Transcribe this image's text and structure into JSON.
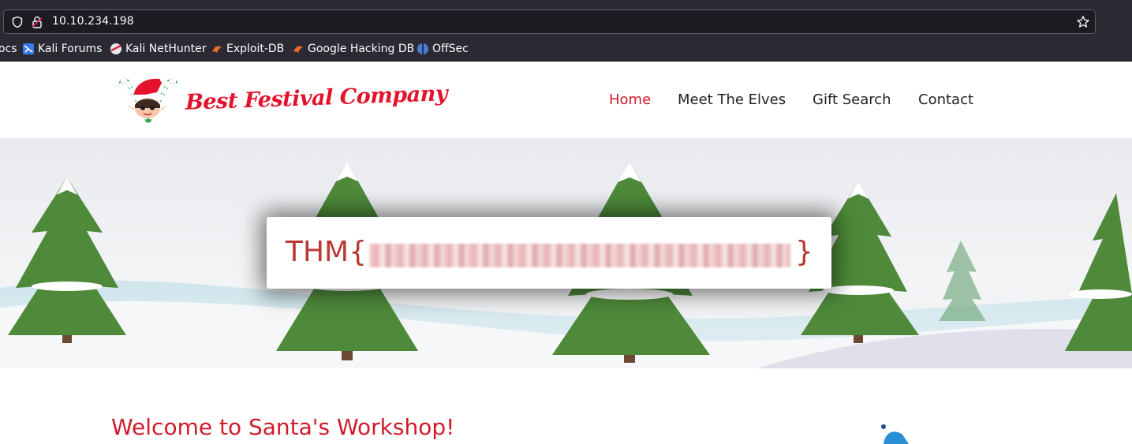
{
  "browser": {
    "url": "10.10.234.198",
    "bookmarks": [
      {
        "label": "ocs",
        "icon": "docs-icon"
      },
      {
        "label": "Kali Forums",
        "icon": "kali-forums-icon"
      },
      {
        "label": "Kali NetHunter",
        "icon": "kali-nethunter-icon"
      },
      {
        "label": "Exploit-DB",
        "icon": "exploit-db-icon"
      },
      {
        "label": "Google Hacking DB",
        "icon": "ghdb-icon"
      },
      {
        "label": "OffSec",
        "icon": "offsec-icon"
      }
    ]
  },
  "site": {
    "brand": "Best Festival Company",
    "nav": [
      "Home",
      "Meet The Elves",
      "Gift Search",
      "Contact"
    ],
    "active_nav": "Home"
  },
  "hero": {
    "flag_prefix": "THM{",
    "flag_suffix": "}"
  },
  "content": {
    "welcome": "Welcome to Santa's Workshop!"
  },
  "colors": {
    "brand_red": "#e4122b",
    "nav_active": "#d01b2b",
    "flag_text": "#b83a33",
    "chrome_bg": "#2b2a33"
  }
}
